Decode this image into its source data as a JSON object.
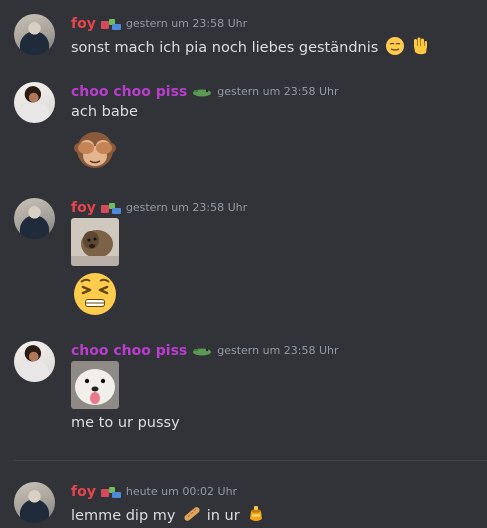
{
  "colors": {
    "background": "#313338",
    "username_foy": "#e6454e",
    "username_choo": "#b93ecf",
    "timestamp": "#949ba4",
    "text": "#dbdee1"
  },
  "messages": [
    {
      "username": "foy",
      "timestamp": "gestern um 23:58 Uhr",
      "text": "sonst mach ich pia noch liebes geständnis",
      "emojis": [
        "relieved-face-emoji",
        "raised-hand-emoji"
      ]
    },
    {
      "username": "choo choo piss",
      "timestamp": "gestern um 23:58 Uhr",
      "text": "ach babe",
      "big_emoji": "see-no-evil-monkey-emoji"
    },
    {
      "username": "foy",
      "timestamp": "gestern um 23:58 Uhr",
      "image": "dog-photo",
      "big_emoji": "persevering-face-emoji"
    },
    {
      "username": "choo choo piss",
      "timestamp": "gestern um 23:58 Uhr",
      "image": "dog-tongue-photo",
      "text": "me to ur pussy"
    },
    {
      "username": "foy",
      "timestamp": "heute um 00:02 Uhr",
      "text_before": "lemme dip my",
      "emoji_mid": "baguette-emoji",
      "text_after": "in ur",
      "emoji_end": "honey-pot-emoji"
    }
  ]
}
